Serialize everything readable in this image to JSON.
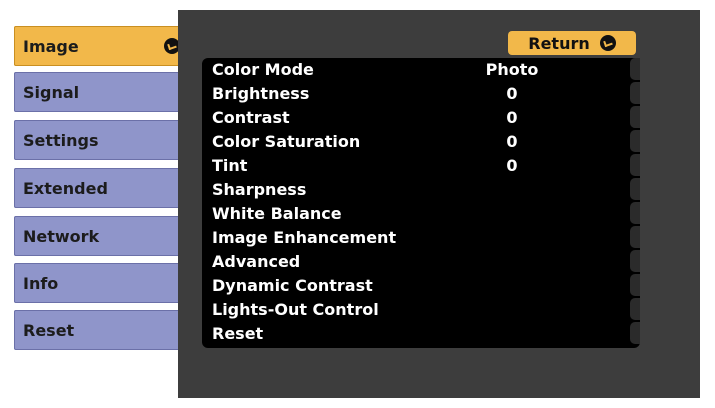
{
  "sidebar": {
    "items": [
      {
        "label": "Image",
        "selected": true
      },
      {
        "label": "Signal"
      },
      {
        "label": "Settings"
      },
      {
        "label": "Extended"
      },
      {
        "label": "Network"
      },
      {
        "label": "Info"
      },
      {
        "label": "Reset"
      }
    ]
  },
  "panel": {
    "return_label": "Return",
    "rows": [
      {
        "label": "Color Mode",
        "value": "Photo"
      },
      {
        "label": "Brightness",
        "value": "0"
      },
      {
        "label": "Contrast",
        "value": "0"
      },
      {
        "label": "Color Saturation",
        "value": "0"
      },
      {
        "label": "Tint",
        "value": "0"
      },
      {
        "label": "Sharpness",
        "value": ""
      },
      {
        "label": "White Balance",
        "value": ""
      },
      {
        "label": "Image Enhancement",
        "value": ""
      },
      {
        "label": "Advanced",
        "value": ""
      },
      {
        "label": "Dynamic Contrast",
        "value": ""
      },
      {
        "label": "Lights-Out Control",
        "value": ""
      },
      {
        "label": "Reset",
        "value": ""
      }
    ]
  },
  "colors": {
    "accent": "#f2b84a",
    "tab": "#8f95ca",
    "panel": "#3d3d3d",
    "menu": "#000000"
  },
  "icons": {
    "enter": "enter-icon"
  }
}
